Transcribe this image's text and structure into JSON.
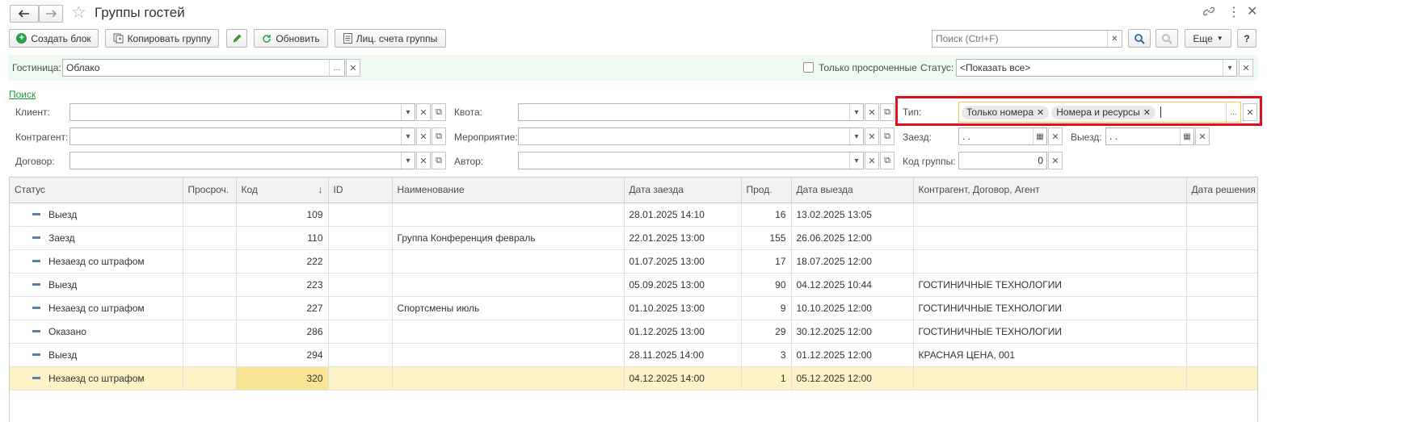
{
  "window": {
    "title": "Группы гостей"
  },
  "toolbar": {
    "create_block": "Создать блок",
    "copy_group": "Копировать группу",
    "refresh": "Обновить",
    "accounts": "Лиц. счета группы",
    "search_placeholder": "Поиск (Ctrl+F)",
    "more": "Еще",
    "help": "?"
  },
  "filters": {
    "hotel_label": "Гостиница:",
    "hotel_value": "Облако",
    "overdue_only": "Только просроченные",
    "status_label": "Статус:",
    "status_value": "<Показать все>"
  },
  "search": {
    "link": "Поиск",
    "client_label": "Клиент:",
    "counterparty_label": "Контрагент:",
    "contract_label": "Договор:",
    "quota_label": "Квота:",
    "event_label": "Мероприятие:",
    "author_label": "Автор:",
    "type_label": "Тип:",
    "type_tags": [
      "Только номера",
      "Номера и ресурсы"
    ],
    "checkin_label": "Заезд:",
    "checkin_value": " .  .",
    "checkout_label": "Выезд:",
    "checkout_value": " .  .",
    "group_code_label": "Код группы:",
    "group_code_value": "0"
  },
  "table": {
    "columns": [
      "Статус",
      "Просроч.",
      "Код",
      "ID",
      "Наименование",
      "Дата заезда",
      "Прод.",
      "Дата выезда",
      "Контрагент, Договор, Агент",
      "Дата решения"
    ],
    "sort_indicator": "↓",
    "rows": [
      {
        "status": "Выезд",
        "overdue": "",
        "code": "109",
        "id": "",
        "name": "",
        "checkin": "28.01.2025 14:10",
        "dur": "16",
        "checkout": "13.02.2025 13:05",
        "agent": "",
        "decision": ""
      },
      {
        "status": "Заезд",
        "overdue": "",
        "code": "110",
        "id": "",
        "name": "Группа Конференция февраль",
        "checkin": "22.01.2025 13:00",
        "dur": "155",
        "checkout": "26.06.2025 12:00",
        "agent": "",
        "decision": ""
      },
      {
        "status": "Незаезд со штрафом",
        "overdue": "",
        "code": "222",
        "id": "",
        "name": "",
        "checkin": "01.07.2025 13:00",
        "dur": "17",
        "checkout": "18.07.2025 12:00",
        "agent": "",
        "decision": ""
      },
      {
        "status": "Выезд",
        "overdue": "",
        "code": "223",
        "id": "",
        "name": "",
        "checkin": "05.09.2025 13:00",
        "dur": "90",
        "checkout": "04.12.2025 10:44",
        "agent": "ГОСТИНИЧНЫЕ ТЕХНОЛОГИИ",
        "decision": ""
      },
      {
        "status": "Незаезд со штрафом",
        "overdue": "",
        "code": "227",
        "id": "",
        "name": "Спортсмены июль",
        "checkin": "01.10.2025 13:00",
        "dur": "9",
        "checkout": "10.10.2025 12:00",
        "agent": "ГОСТИНИЧНЫЕ ТЕХНОЛОГИИ",
        "decision": ""
      },
      {
        "status": "Оказано",
        "overdue": "",
        "code": "286",
        "id": "",
        "name": "",
        "checkin": "01.12.2025 13:00",
        "dur": "29",
        "checkout": "30.12.2025 12:00",
        "agent": "ГОСТИНИЧНЫЕ ТЕХНОЛОГИИ",
        "decision": ""
      },
      {
        "status": "Выезд",
        "overdue": "",
        "code": "294",
        "id": "",
        "name": "",
        "checkin": "28.11.2025 14:00",
        "dur": "3",
        "checkout": "01.12.2025 12:00",
        "agent": "КРАСНАЯ ЦЕНА, 001",
        "decision": ""
      },
      {
        "status": "Незаезд со штрафом",
        "overdue": "",
        "code": "320",
        "id": "",
        "name": "",
        "checkin": "04.12.2025 14:00",
        "dur": "1",
        "checkout": "05.12.2025 12:00",
        "agent": "",
        "decision": ""
      }
    ],
    "selected_row": 7
  },
  "colors": {
    "accent_green": "#1a9a3c",
    "highlight_red": "#e0101c",
    "selected_row": "#fbf2c6",
    "filter_bar": "#effaf0"
  }
}
